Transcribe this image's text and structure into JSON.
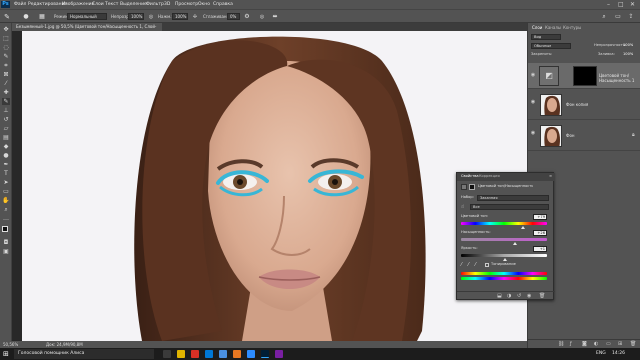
{
  "menubar": {
    "app_logo": "Ps",
    "items": [
      "Файл",
      "Редактирование",
      "Изображение",
      "Слои",
      "Текст",
      "Выделение",
      "Фильтр",
      "3D",
      "Просмотр",
      "Окно",
      "Справка"
    ],
    "window_controls": [
      "–",
      "□",
      "✕"
    ]
  },
  "options": {
    "mode_label": "Режим:",
    "mode_value": "Нормальный",
    "opacity_label": "Непрозр.:",
    "opacity_value": "100%",
    "pressure_label": "Нажм.:",
    "pressure_value": "100%",
    "smoothing_label": "Сглаживание:",
    "smoothing_value": "0%"
  },
  "document_tab": {
    "title": "Безымянный-1.jpg @ 50,5% (Цветовой тон/Насыщенность 1, Слой-маска/8) *"
  },
  "status": {
    "zoom": "50,56%",
    "doc_info": "Док: 24,9М/90,8М"
  },
  "panels": {
    "tabs": [
      "Слои",
      "Каналы",
      "Контуры"
    ],
    "search_placeholder": "Вид",
    "blend_mode": "Обычные",
    "opacity_label": "Непрозрачность:",
    "opacity_value": "100%",
    "lock_label": "Закрепить:",
    "fill_label": "Заливка:",
    "fill_value": "100%",
    "layers": [
      {
        "name": "Цветовой тон/Насыщенность 1",
        "type": "adjustment",
        "selected": true
      },
      {
        "name": "Фон копия",
        "type": "photo",
        "selected": false
      },
      {
        "name": "Фон",
        "type": "photo",
        "selected": false
      }
    ]
  },
  "properties": {
    "tabs": [
      "Свойства",
      "Коррекция"
    ],
    "title": "Цветовой тон/Насыщенность",
    "preset_label": "Набор:",
    "preset_value": "Заказная",
    "channel_value": "Все",
    "hue_label": "Цветовой тон:",
    "hue_value": "+79",
    "saturation_label": "Насыщенность:",
    "saturation_value": "+26",
    "lightness_label": "Яркость:",
    "lightness_value": "+1",
    "colorize_label": "Тонирование",
    "hue_level": 0.72,
    "saturation_level": 0.63,
    "lightness_level": 0.51
  },
  "taskbar": {
    "search_text": "Голосовой помощник Алиса",
    "lang": "ENG",
    "time": "14:26"
  }
}
